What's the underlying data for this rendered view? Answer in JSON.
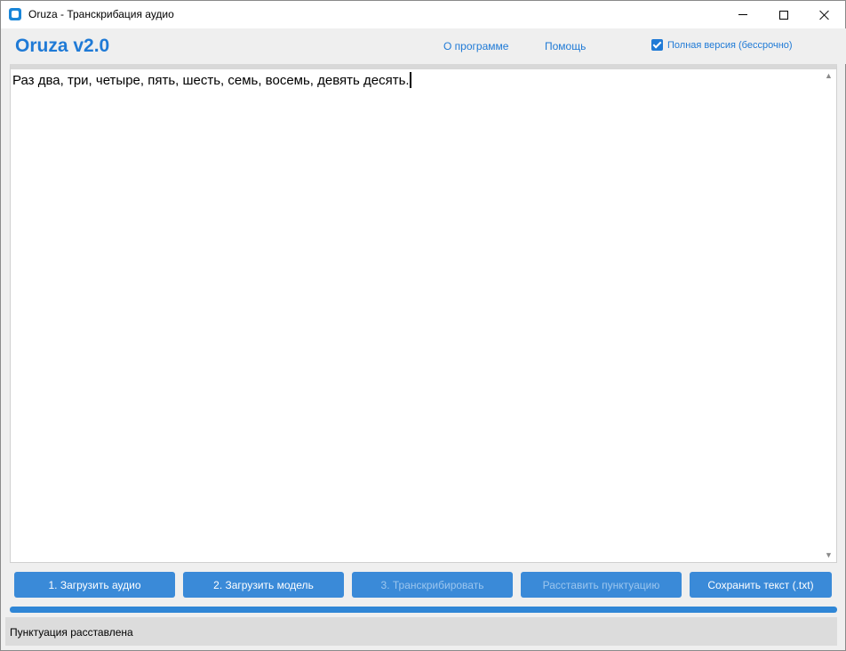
{
  "window": {
    "title": "Oruza - Транскрибация аудио"
  },
  "header": {
    "app_title": "Oruza v2.0",
    "about_link": "О программе",
    "help_link": "Помощь",
    "full_version_label": "Полная версия (бессрочно)",
    "full_version_checked": true
  },
  "editor": {
    "text": "Раз два, три, четыре, пять, шесть, семь, восемь, девять десять."
  },
  "actions": {
    "load_audio": "1. Загрузить аудио",
    "load_model": "2. Загрузить модель",
    "transcribe": "3. Транскрибировать",
    "punctuate": "Расставить пунктуацию",
    "save_text": "Сохранить текст (.txt)"
  },
  "progress": {
    "value_percent": 100
  },
  "status": {
    "text": "Пунктуация расставлена"
  },
  "colors": {
    "accent": "#1f7ad6",
    "button": "#3a8ad8",
    "progress": "#2f86d6"
  }
}
